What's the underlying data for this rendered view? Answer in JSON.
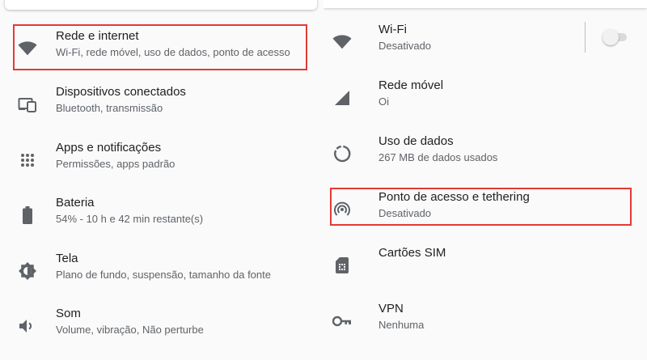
{
  "left": {
    "items": [
      {
        "title": "Rede e internet",
        "subtitle": "Wi-Fi, rede móvel, uso de dados, ponto de acesso",
        "icon": "wifi-icon"
      },
      {
        "title": "Dispositivos conectados",
        "subtitle": "Bluetooth, transmissão",
        "icon": "connected-devices-icon"
      },
      {
        "title": "Apps e notificações",
        "subtitle": "Permissões, apps padrão",
        "icon": "apps-grid-icon"
      },
      {
        "title": "Bateria",
        "subtitle": "54% - 10 h e 42 min restante(s)",
        "icon": "battery-icon"
      },
      {
        "title": "Tela",
        "subtitle": "Plano de fundo, suspensão, tamanho da fonte",
        "icon": "brightness-icon"
      },
      {
        "title": "Som",
        "subtitle": "Volume, vibração, Não perturbe",
        "icon": "volume-icon"
      }
    ]
  },
  "right": {
    "items": [
      {
        "title": "Wi-Fi",
        "subtitle": "Desativado",
        "icon": "wifi-icon",
        "toggle_on": false
      },
      {
        "title": "Rede móvel",
        "subtitle": "Oi",
        "icon": "signal-icon"
      },
      {
        "title": "Uso de dados",
        "subtitle": "267 MB de dados usados",
        "icon": "data-usage-icon"
      },
      {
        "title": "Ponto de acesso e tethering",
        "subtitle": "Desativado",
        "icon": "hotspot-icon"
      },
      {
        "title": "Cartões SIM",
        "subtitle": "",
        "icon": "sim-card-icon"
      },
      {
        "title": "VPN",
        "subtitle": "Nenhuma",
        "icon": "vpn-key-icon"
      }
    ]
  },
  "colors": {
    "highlight": "#e53935",
    "icon": "#5f6368",
    "background": "#fafafa"
  }
}
